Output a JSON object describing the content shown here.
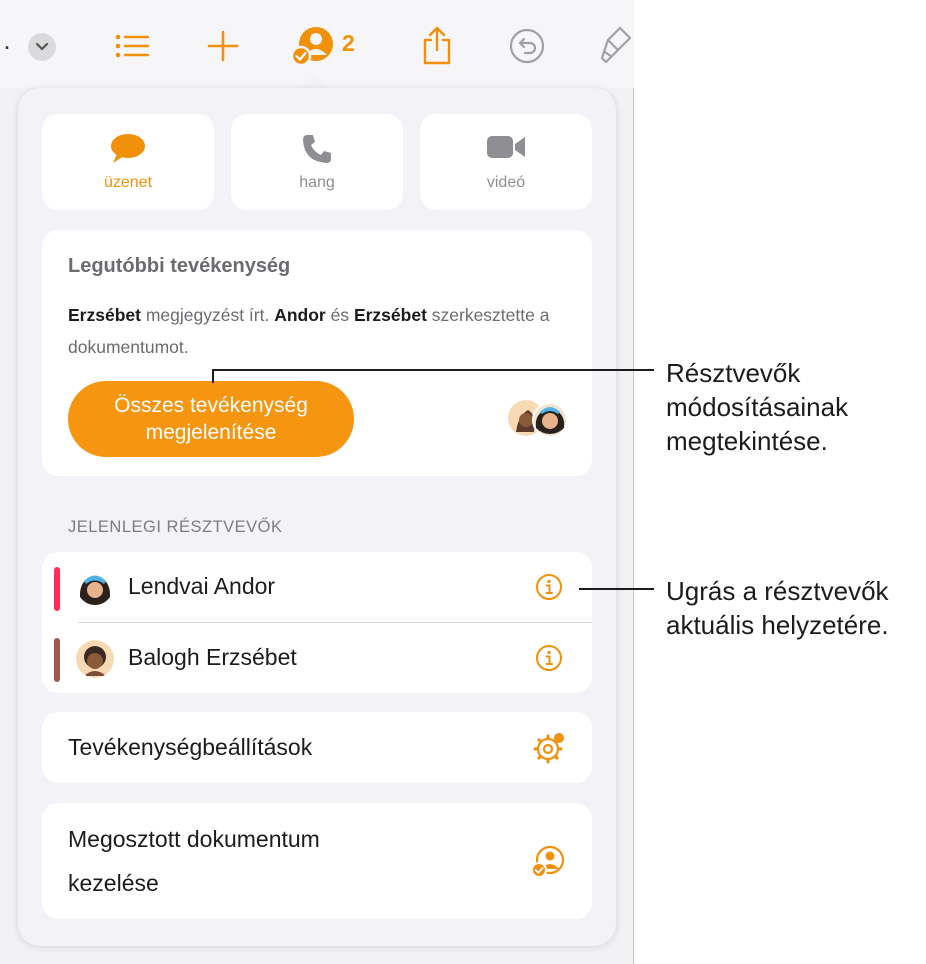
{
  "toolbar": {
    "more_glyph": ".",
    "collaborator_count": "2"
  },
  "communication": [
    {
      "label": "üzenet",
      "active": true,
      "icon": "message-bubble-icon"
    },
    {
      "label": "hang",
      "active": false,
      "icon": "phone-icon"
    },
    {
      "label": "videó",
      "active": false,
      "icon": "video-camera-icon"
    }
  ],
  "activity": {
    "title": "Legutóbbi tevékenység",
    "name1": "Erzsébet",
    "text1": " megjegyzést írt. ",
    "name2": "Andor",
    "text2": " és ",
    "name3": "Erzsébet",
    "text3": " szerkesztette a dokumentumot.",
    "button_line1": "Összes tevékenység",
    "button_line2": "megjelenítése"
  },
  "participants_header": "JELENLEGI RÉSZTVEVŐK",
  "participants": [
    {
      "name": "Lendvai Andor",
      "color": "#ff2d55"
    },
    {
      "name": "Balogh Erzsébet",
      "color": "#a2564f"
    }
  ],
  "settings_label": "Tevékenységbeállítások",
  "manage_line1": "Megosztott dokumentum",
  "manage_line2": "kezelése",
  "callouts": {
    "top": [
      "Résztvevők",
      "módosításainak",
      "megtekintése."
    ],
    "bottom": [
      "Ugrás a résztvevők",
      "aktuális helyzetére."
    ]
  },
  "colors": {
    "accent": "#f6950f",
    "icon_gray": "#8e8e93"
  }
}
